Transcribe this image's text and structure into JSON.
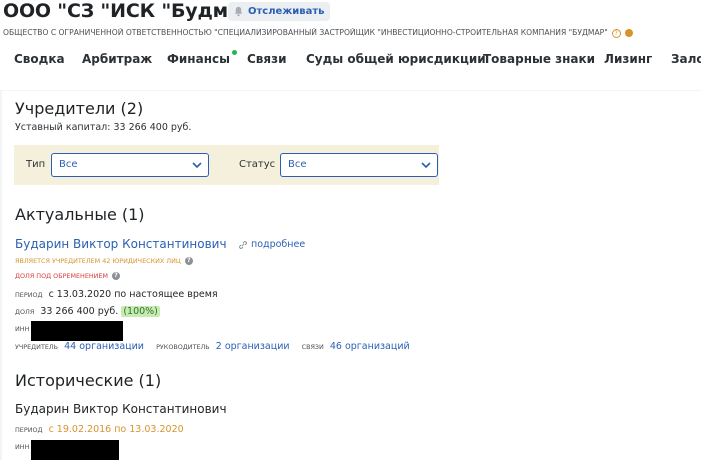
{
  "header": {
    "title": "ООО \"СЗ \"ИСК \"Будмар\"",
    "track_label": "Отслеживать",
    "full_name": "ОБЩЕСТВО С ОГРАНИЧЕННОЙ ОТВЕТСТВЕННОСТЬЮ \"СПЕЦИАЛИЗИРОВАННЫЙ ЗАСТРОЙЩИК \"ИНВЕСТИЦИОННО-СТРОИТЕЛЬНАЯ КОМПАНИЯ \"БУДМАР\"",
    "status_color": "#d9922b"
  },
  "tabs": [
    {
      "label": "Сводка"
    },
    {
      "label": "Арбитраж"
    },
    {
      "label": "Финансы",
      "has_new": true
    },
    {
      "label": "Связи"
    },
    {
      "label": "Суды общей юрисдикции"
    },
    {
      "label": "Товарные знаки"
    },
    {
      "label": "Лизинг"
    },
    {
      "label": "Залоги"
    }
  ],
  "founders": {
    "heading": "Учредители (2)",
    "capital": "Уставный капитал: 33 266 400 руб.",
    "filters": {
      "type_label": "Тип",
      "type_value": "Все",
      "status_label": "Статус",
      "status_value": "Все"
    },
    "actual": {
      "heading": "Актуальные (1)",
      "name": "Бударин Виктор Константинович",
      "more_label": "подробнее",
      "founder_of": "Является учредителем 42 юридических лиц",
      "encumbrance": "Доля под обременением",
      "period_label": "период",
      "period_value": "с 13.03.2020 по настоящее время",
      "share_label": "доля",
      "share_value": "33 266 400 руб.",
      "share_pct": "(100%)",
      "inn_label": "ИНН",
      "founder_label": "учредитель",
      "founder_link": "44 организации",
      "head_label": "руководитель",
      "head_link": "2 организации",
      "links_label": "связи",
      "links_link": "46 организаций"
    },
    "historical": {
      "heading": "Исторические (1)",
      "name": "Бударин Виктор Константинович",
      "period_label": "период",
      "period_value": "с 19.02.2016 по 13.03.2020",
      "inn_label": "ИНН"
    }
  }
}
